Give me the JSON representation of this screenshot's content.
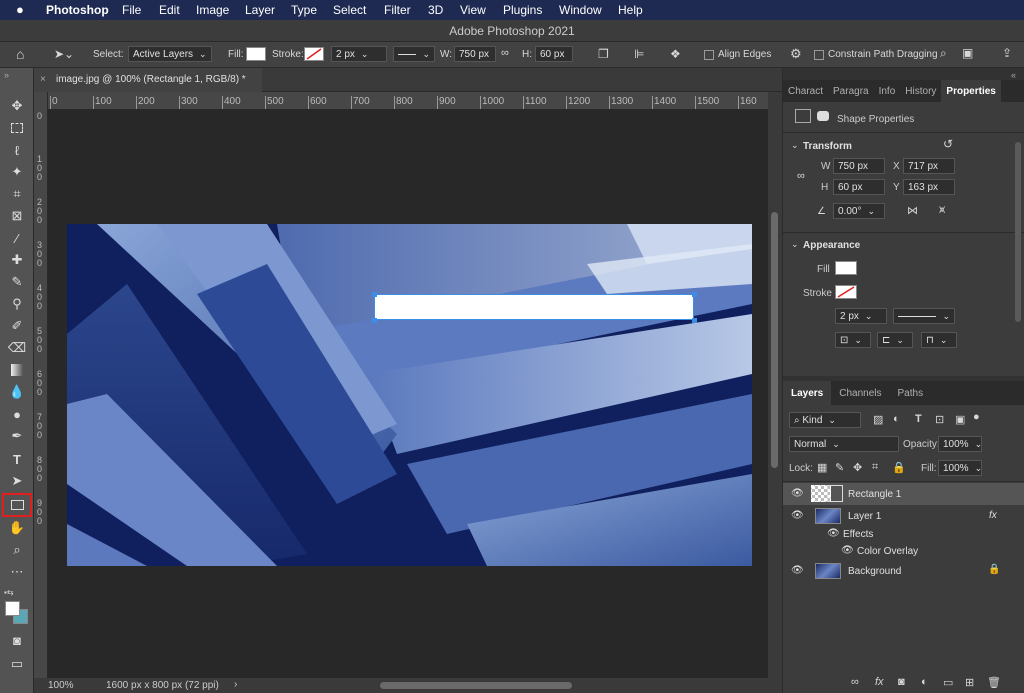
{
  "menubar": {
    "apple": "",
    "items": [
      "Photoshop",
      "File",
      "Edit",
      "Image",
      "Layer",
      "Type",
      "Select",
      "Filter",
      "3D",
      "View",
      "Plugins",
      "Window",
      "Help"
    ]
  },
  "titlebar": {
    "title": "Adobe Photoshop 2021"
  },
  "options": {
    "select_label": "Select:",
    "select_value": "Active Layers",
    "fill_label": "Fill:",
    "stroke_label": "Stroke:",
    "stroke_width": "2 px",
    "w_label": "W:",
    "w_value": "750 px",
    "h_label": "H:",
    "h_value": "60 px",
    "align_edges": "Align Edges",
    "constrain": "Constrain Path Dragging"
  },
  "document": {
    "tab_title": "image.jpg @ 100% (Rectangle 1, RGB/8) *",
    "ruler_top": [
      "0",
      "100",
      "200",
      "300",
      "400",
      "500",
      "600",
      "700",
      "800",
      "900",
      "1000",
      "1100",
      "1200",
      "1300",
      "1400",
      "1500",
      "160"
    ],
    "ruler_left": [
      "0",
      "1 0 0",
      "2 0 0",
      "3 0 0",
      "4 0 0",
      "5 0 0",
      "6 0 0",
      "7 0 0",
      "8 0 0",
      "9 0 0"
    ],
    "zoom": "100%",
    "doc_info": "1600 px x 800 px (72 ppi)"
  },
  "properties": {
    "tabs": [
      "Charact",
      "Paragra",
      "Info",
      "History",
      "Properties"
    ],
    "shape_properties": "Shape Properties",
    "transform": {
      "title": "Transform",
      "w_label": "W",
      "w_value": "750 px",
      "x_label": "X",
      "x_value": "717 px",
      "h_label": "H",
      "h_value": "60 px",
      "y_label": "Y",
      "y_value": "163 px",
      "angle": "0.00°"
    },
    "appearance": {
      "title": "Appearance",
      "fill_label": "Fill",
      "stroke_label": "Stroke",
      "stroke_width": "2 px"
    }
  },
  "layers": {
    "tabs": [
      "Layers",
      "Channels",
      "Paths"
    ],
    "kind": "Kind",
    "blend_mode": "Normal",
    "opacity_label": "Opacity:",
    "opacity_value": "100%",
    "lock_label": "Lock:",
    "fill_label": "Fill:",
    "fill_value": "100%",
    "rows": {
      "rect": "Rectangle 1",
      "layer1": "Layer 1",
      "fx": "fx",
      "effects": "Effects",
      "overlay": "Color Overlay",
      "background": "Background"
    }
  },
  "colors": {
    "accent": "#1e2a52",
    "highlight": "#e02020"
  }
}
